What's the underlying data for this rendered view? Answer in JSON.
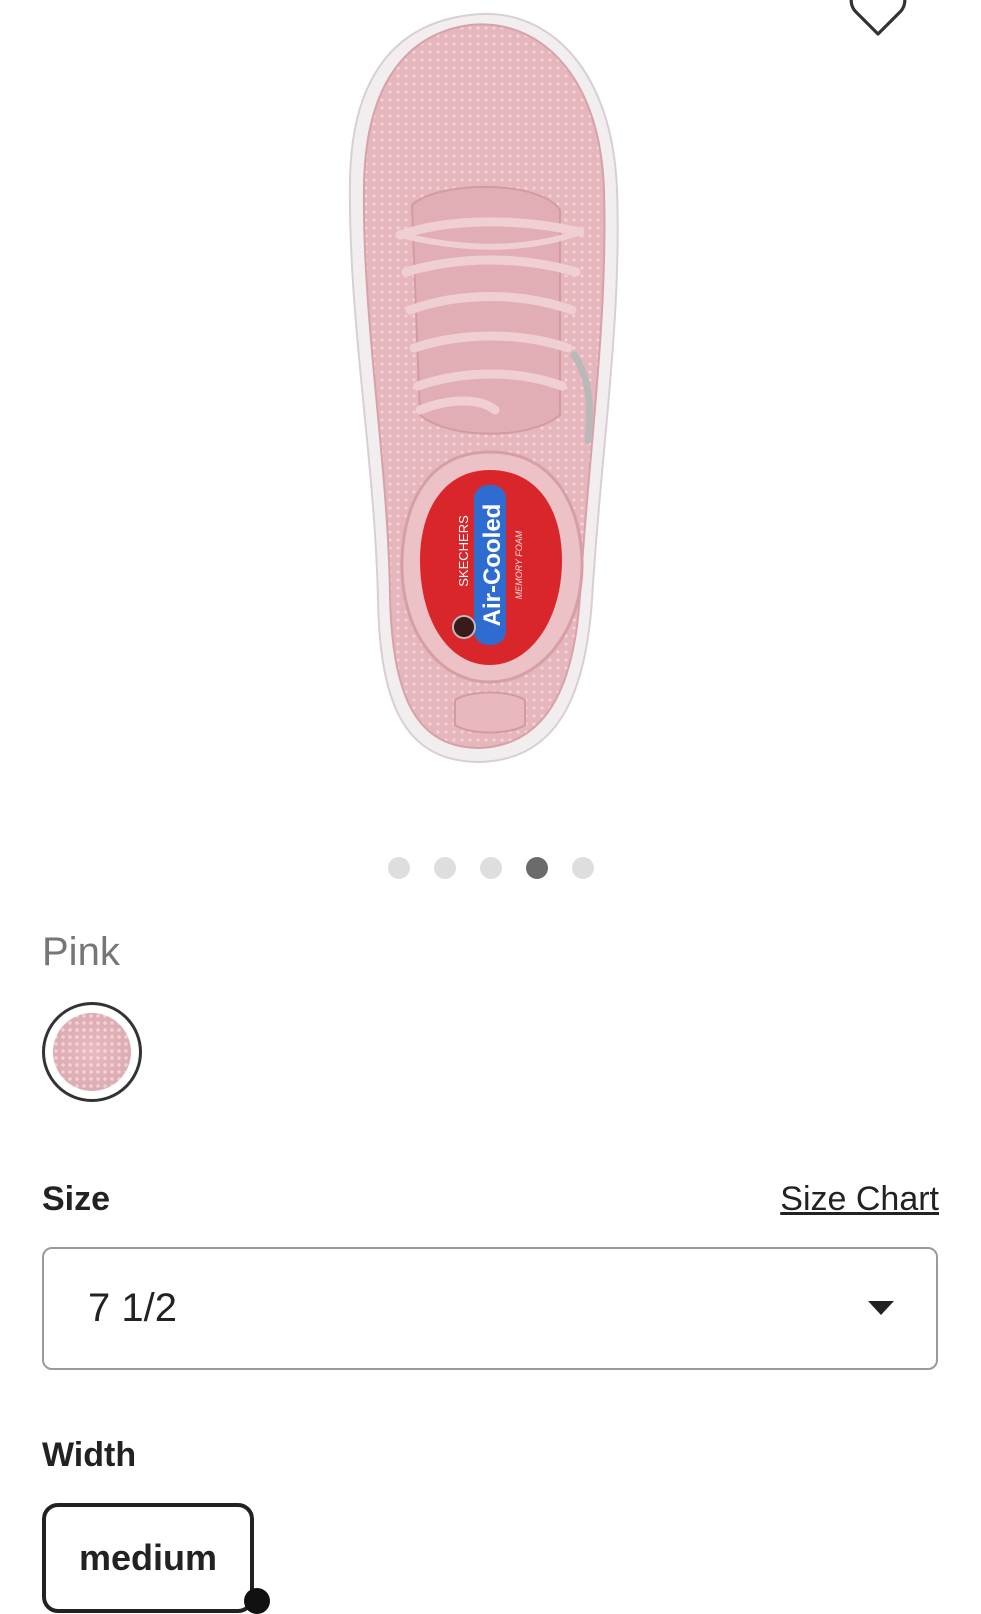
{
  "icons": {
    "favorite": "heart-outline-icon",
    "dropdown": "caret-down-icon"
  },
  "colors": {
    "product": "#e8b9bf",
    "insole": "#d9262b",
    "insole_badge": "#2f6ccf",
    "dot_active": "#6b6b6b",
    "dot_inactive": "#dedede"
  },
  "product_image": {
    "insole_brand": "SKECHERS",
    "insole_tech": "Air-Cooled",
    "insole_sub": "MEMORY FOAM"
  },
  "carousel": {
    "total": 5,
    "active_index": 4
  },
  "color": {
    "selected_name": "Pink"
  },
  "size": {
    "label": "Size",
    "chart_link": "Size Chart",
    "selected": "7 1/2"
  },
  "width": {
    "label": "Width",
    "options": [
      {
        "label": "medium",
        "selected": true
      }
    ]
  }
}
